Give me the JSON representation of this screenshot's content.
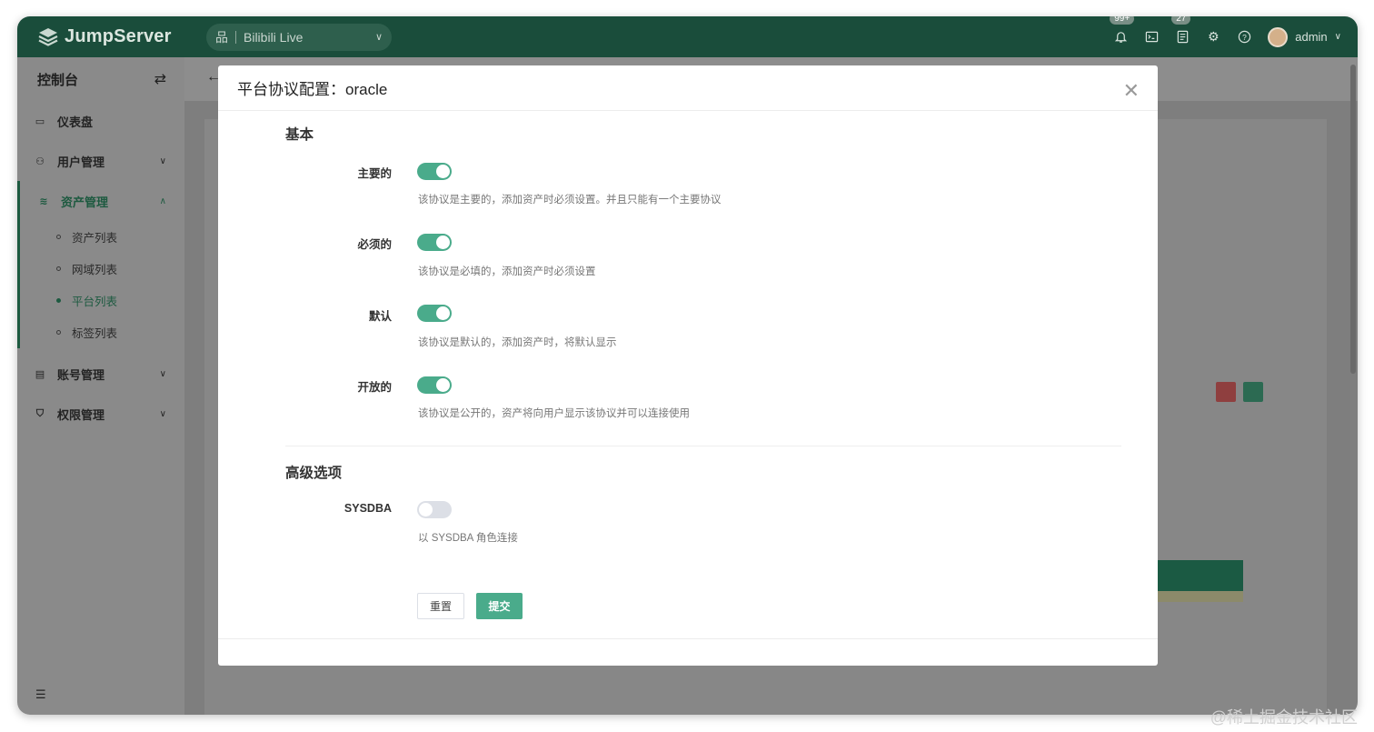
{
  "topbar": {
    "brand": "JumpServer",
    "org": "Bilibili Live",
    "notifications_badge": "99+",
    "tickets_badge": "27",
    "user": "admin"
  },
  "sidebar": {
    "title": "控制台",
    "items": [
      {
        "label": "仪表盘",
        "icon": "dashboard-icon"
      },
      {
        "label": "用户管理",
        "icon": "users-icon"
      },
      {
        "label": "资产管理",
        "icon": "layers-icon"
      },
      {
        "label": "账号管理",
        "icon": "account-icon"
      },
      {
        "label": "权限管理",
        "icon": "shield-icon"
      }
    ],
    "sub_items": [
      "资产列表",
      "网域列表",
      "平台列表",
      "标签列表"
    ]
  },
  "modal": {
    "title": "平台协议配置：oracle",
    "section_basic": "基本",
    "section_advanced": "高级选项",
    "fields": [
      {
        "label": "主要的",
        "on": true,
        "help": "该协议是主要的，添加资产时必须设置。并且只能有一个主要协议"
      },
      {
        "label": "必须的",
        "on": true,
        "help": "该协议是必填的，添加资产时必须设置"
      },
      {
        "label": "默认",
        "on": true,
        "help": "该协议是默认的，添加资产时，将默认显示"
      },
      {
        "label": "开放的",
        "on": true,
        "help": "该协议是公开的，资产将向用户显示该协议并可以连接使用"
      }
    ],
    "advanced_field": {
      "label": "SYSDBA",
      "on": false,
      "help": "以 SYSDBA 角色连接"
    },
    "reset_label": "重置",
    "submit_label": "提交"
  },
  "watermark": "@稀土掘金技术社区",
  "colors": {
    "topbar": "#1a4d3b",
    "accent": "#4aab8b"
  }
}
